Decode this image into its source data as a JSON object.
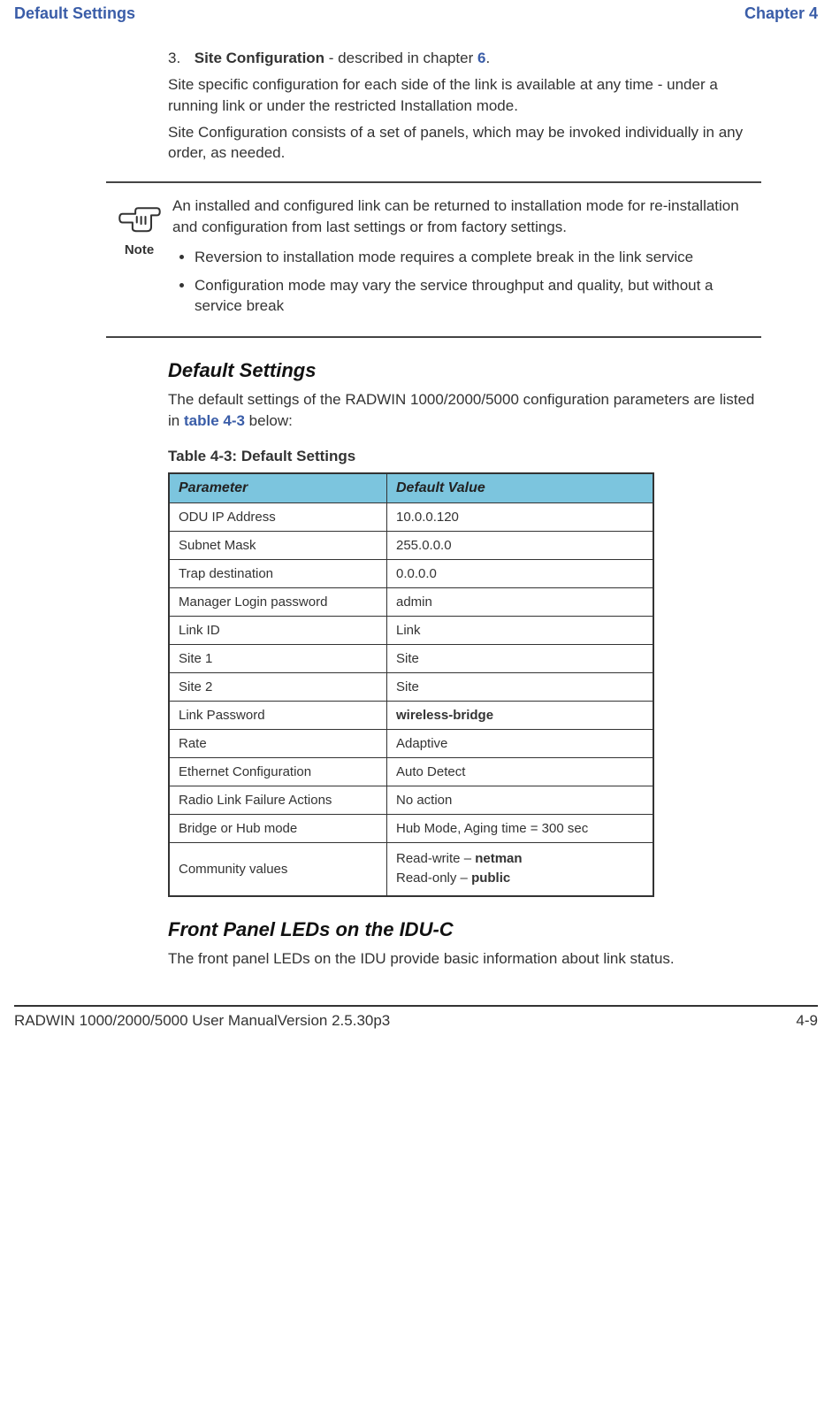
{
  "header": {
    "left": "Default Settings",
    "right": "Chapter 4"
  },
  "list3": {
    "num": "3.",
    "bold": "Site Configuration",
    "rest": " - described in chapter ",
    "ref": "6",
    "end": "."
  },
  "paragraphs": {
    "p1": "Site specific configuration for each side of the link is available at any time - under a running link or under the restricted Installation mode.",
    "p2": "Site Configuration consists of a set of panels, which may be invoked individually in any order, as needed."
  },
  "note": {
    "label": "Note",
    "intro": "An installed and configured link can be returned to installation mode for re-installation and configuration from last settings or from factory settings.",
    "bullets": [
      "Reversion to installation mode requires a complete break in the link service",
      "Configuration mode may vary the service throughput and quality, but without a service break"
    ]
  },
  "sections": {
    "defaultSettings": {
      "heading": "Default Settings",
      "text1": "The default settings of the RADWIN 1000/2000/5000 configuration parameters are listed in ",
      "ref": "table 4-3",
      "text2": " below:"
    },
    "leds": {
      "heading": "Front Panel LEDs on the IDU-C",
      "text": "The front panel LEDs on the IDU provide basic information about link status."
    }
  },
  "table": {
    "caption": "Table 4-3: Default Settings",
    "headers": {
      "col1": "Parameter",
      "col2": "Default Value"
    },
    "rows": [
      {
        "param": "ODU IP Address",
        "value": "10.0.0.120"
      },
      {
        "param": "Subnet Mask",
        "value": "255.0.0.0"
      },
      {
        "param": "Trap destination",
        "value": "0.0.0.0"
      },
      {
        "param": "Manager Login password",
        "value": "admin"
      },
      {
        "param": "Link ID",
        "value": "Link"
      },
      {
        "param": "Site 1",
        "value": "Site"
      },
      {
        "param": "Site 2",
        "value": "Site"
      },
      {
        "param": "Link Password",
        "value_bold": "wireless-bridge"
      },
      {
        "param": "Rate",
        "value": "Adaptive"
      },
      {
        "param": "Ethernet Configuration",
        "value": "Auto Detect"
      },
      {
        "param": "Radio Link Failure Actions",
        "value": "No action"
      },
      {
        "param": "Bridge or Hub mode",
        "value": "Hub Mode, Aging time = 300 sec"
      },
      {
        "param": "Community values",
        "value_multi": {
          "line1a": "Read-write – ",
          "line1b": "netman",
          "line2a": "Read-only – ",
          "line2b": "public"
        }
      }
    ]
  },
  "footer": {
    "left": "RADWIN 1000/2000/5000 User ManualVersion  2.5.30p3",
    "right": "4-9"
  }
}
